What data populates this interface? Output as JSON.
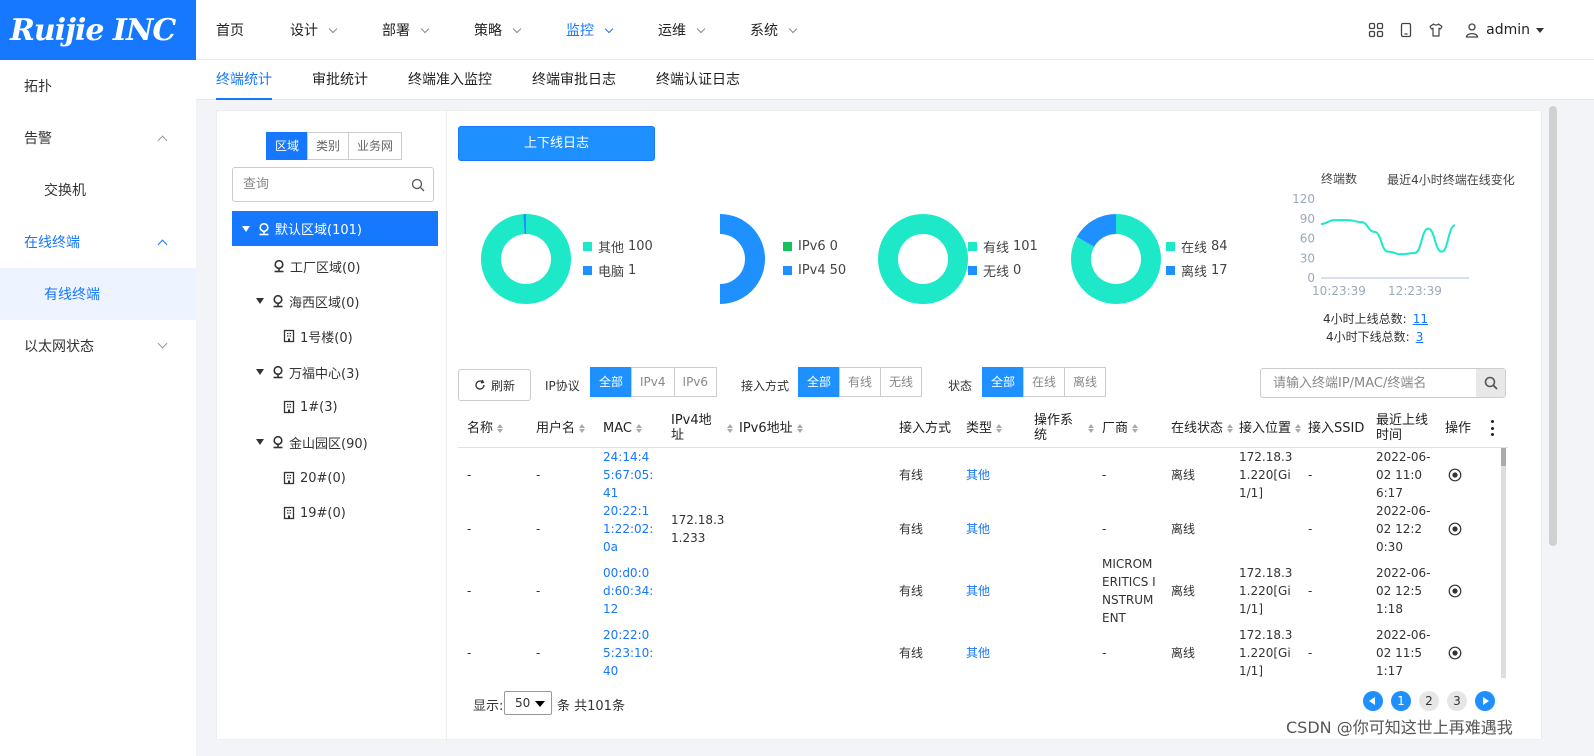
{
  "brand": {
    "logo_text": "Ruijie INC"
  },
  "nav": {
    "items": [
      {
        "label": "首页",
        "has_arrow": false,
        "active": false
      },
      {
        "label": "设计",
        "has_arrow": true,
        "active": false
      },
      {
        "label": "部署",
        "has_arrow": true,
        "active": false
      },
      {
        "label": "策略",
        "has_arrow": true,
        "active": false
      },
      {
        "label": "监控",
        "has_arrow": true,
        "active": true
      },
      {
        "label": "运维",
        "has_arrow": true,
        "active": false
      },
      {
        "label": "系统",
        "has_arrow": true,
        "active": false
      }
    ]
  },
  "header_right": {
    "icons": [
      "grid-icon",
      "tablet-icon",
      "shirt-icon",
      "user-icon"
    ],
    "user": "admin"
  },
  "sidebar": {
    "items": [
      {
        "label": "拓扑",
        "type": "item"
      },
      {
        "label": "告警",
        "type": "group",
        "arrow": "up"
      },
      {
        "label": "交换机",
        "type": "sub"
      },
      {
        "label": "在线终端",
        "type": "group",
        "arrow": "up",
        "open": true
      },
      {
        "label": "有线终端",
        "type": "sub",
        "selected": true
      },
      {
        "label": "以太网状态",
        "type": "group",
        "arrow": "down"
      }
    ]
  },
  "subtabs": [
    {
      "label": "终端统计",
      "active": true
    },
    {
      "label": "审批统计",
      "active": false
    },
    {
      "label": "终端准入监控",
      "active": false
    },
    {
      "label": "终端审批日志",
      "active": false
    },
    {
      "label": "终端认证日志",
      "active": false
    }
  ],
  "tree": {
    "segments": [
      {
        "label": "区域",
        "active": true
      },
      {
        "label": "类别",
        "active": false
      },
      {
        "label": "业务网",
        "active": false
      }
    ],
    "search_placeholder": "查询",
    "nodes": [
      {
        "label": "默认区域(101)",
        "icon": "location-pin-icon",
        "expanded": true,
        "selected": true
      },
      {
        "label": "工厂区域(0)",
        "icon": "location-pin-icon",
        "expanded": false
      },
      {
        "label": "海西区域(0)",
        "icon": "location-pin-icon",
        "expanded": true
      },
      {
        "label": "1号楼(0)",
        "icon": "building-icon",
        "expanded": false
      },
      {
        "label": "万福中心(3)",
        "icon": "location-pin-icon",
        "expanded": true
      },
      {
        "label": "1#(3)",
        "icon": "building-icon",
        "expanded": false
      },
      {
        "label": "金山园区(90)",
        "icon": "location-pin-icon",
        "expanded": true
      },
      {
        "label": "20#(0)",
        "icon": "building-icon",
        "expanded": false
      },
      {
        "label": "19#(0)",
        "icon": "building-icon",
        "expanded": false
      }
    ]
  },
  "log_button": "上下线日志",
  "colors": {
    "teal": "#1de9c9",
    "blue": "#1e90ff",
    "green": "#13c25a",
    "accent": "#1677ff"
  },
  "chart_data": [
    {
      "type": "pie",
      "style": "donut",
      "slices": [
        {
          "name": "其他",
          "value": 100,
          "color": "#1de9c9"
        },
        {
          "name": "电脑",
          "value": 1,
          "color": "#1e90ff"
        }
      ]
    },
    {
      "type": "pie",
      "style": "donut",
      "slices": [
        {
          "name": "IPv6",
          "value": 0,
          "color": "#13c25a"
        },
        {
          "name": "IPv4",
          "value": 50,
          "color": "#1e90ff"
        }
      ]
    },
    {
      "type": "pie",
      "style": "donut",
      "slices": [
        {
          "name": "有线",
          "value": 101,
          "color": "#1de9c9"
        },
        {
          "name": "无线",
          "value": 0,
          "color": "#1e90ff"
        }
      ]
    },
    {
      "type": "pie",
      "style": "donut",
      "slices": [
        {
          "name": "在线",
          "value": 84,
          "color": "#1de9c9"
        },
        {
          "name": "离线",
          "value": 17,
          "color": "#1e90ff"
        }
      ]
    },
    {
      "type": "line",
      "title": "最近4小时终端在线变化",
      "ylabel": "终端数",
      "ylim": [
        0,
        120
      ],
      "yticks": [
        0,
        30,
        60,
        90,
        120
      ],
      "xtick_labels": [
        "10:23:39",
        "12:23:39"
      ],
      "series": [
        {
          "values": [
            82,
            88,
            88,
            85,
            70,
            40,
            36,
            38,
            75,
            40,
            80
          ]
        }
      ]
    }
  ],
  "stats": {
    "online_label": "4小时上线总数:",
    "online_value": "11",
    "offline_label": "4小时下线总数:",
    "offline_value": "3"
  },
  "filters": {
    "refresh": "刷新",
    "ip_label": "IP协议",
    "ip_options": [
      {
        "label": "全部",
        "active": true
      },
      {
        "label": "IPv4",
        "active": false
      },
      {
        "label": "IPv6",
        "active": false
      }
    ],
    "access_label": "接入方式",
    "access_options": [
      {
        "label": "全部",
        "active": true
      },
      {
        "label": "有线",
        "active": false
      },
      {
        "label": "无线",
        "active": false
      }
    ],
    "status_label": "状态",
    "status_options": [
      {
        "label": "全部",
        "active": true
      },
      {
        "label": "在线",
        "active": false
      },
      {
        "label": "离线",
        "active": false
      }
    ],
    "search_placeholder": "请输入终端IP/MAC/终端名"
  },
  "table": {
    "columns": [
      {
        "label": "名称",
        "sortable": true
      },
      {
        "label": "用户名",
        "sortable": true
      },
      {
        "label": "MAC",
        "sortable": true
      },
      {
        "label": "IPv4地址",
        "sortable": true
      },
      {
        "label": "IPv6地址",
        "sortable": true
      },
      {
        "label": "接入方式",
        "sortable": false
      },
      {
        "label": "类型",
        "sortable": true
      },
      {
        "label": "操作系统",
        "sortable": true
      },
      {
        "label": "厂商",
        "sortable": true
      },
      {
        "label": "在线状态",
        "sortable": true
      },
      {
        "label": "接入位置",
        "sortable": true
      },
      {
        "label": "接入SSID",
        "sortable": false
      },
      {
        "label": "最近上线时间",
        "sortable": false
      },
      {
        "label": "操作",
        "sortable": false
      }
    ],
    "rows": [
      [
        "-",
        "-",
        "24:14:45:67:05:41",
        "",
        "",
        "有线",
        "其他",
        "",
        "-",
        "离线",
        "172.18.31.220[Gi1/1]",
        "-",
        "2022-06-02 11:06:17"
      ],
      [
        "-",
        "-",
        "20:22:11:22:02:0a",
        "172.18.31.233",
        "",
        "有线",
        "其他",
        "",
        "-",
        "离线",
        "",
        "-",
        "2022-06-02 12:20:30"
      ],
      [
        "-",
        "-",
        "00:d0:0d:60:34:12",
        "",
        "",
        "有线",
        "其他",
        "",
        "MICROMERITICS INSTRUMENT",
        "离线",
        "172.18.31.220[Gi1/1]",
        "-",
        "2022-06-02 12:51:18"
      ],
      [
        "-",
        "-",
        "20:22:05:23:10:40",
        "",
        "",
        "有线",
        "其他",
        "",
        "-",
        "离线",
        "172.18.31.220[Gi1/1]",
        "-",
        "2022-06-02 11:51:17"
      ]
    ]
  },
  "footer": {
    "show_label": "显示:",
    "page_size": "50",
    "total_text": "条 共101条",
    "pages": [
      "1",
      "2",
      "3"
    ],
    "current_page": "1"
  },
  "watermark": "CSDN @你可知这世上再难遇我"
}
